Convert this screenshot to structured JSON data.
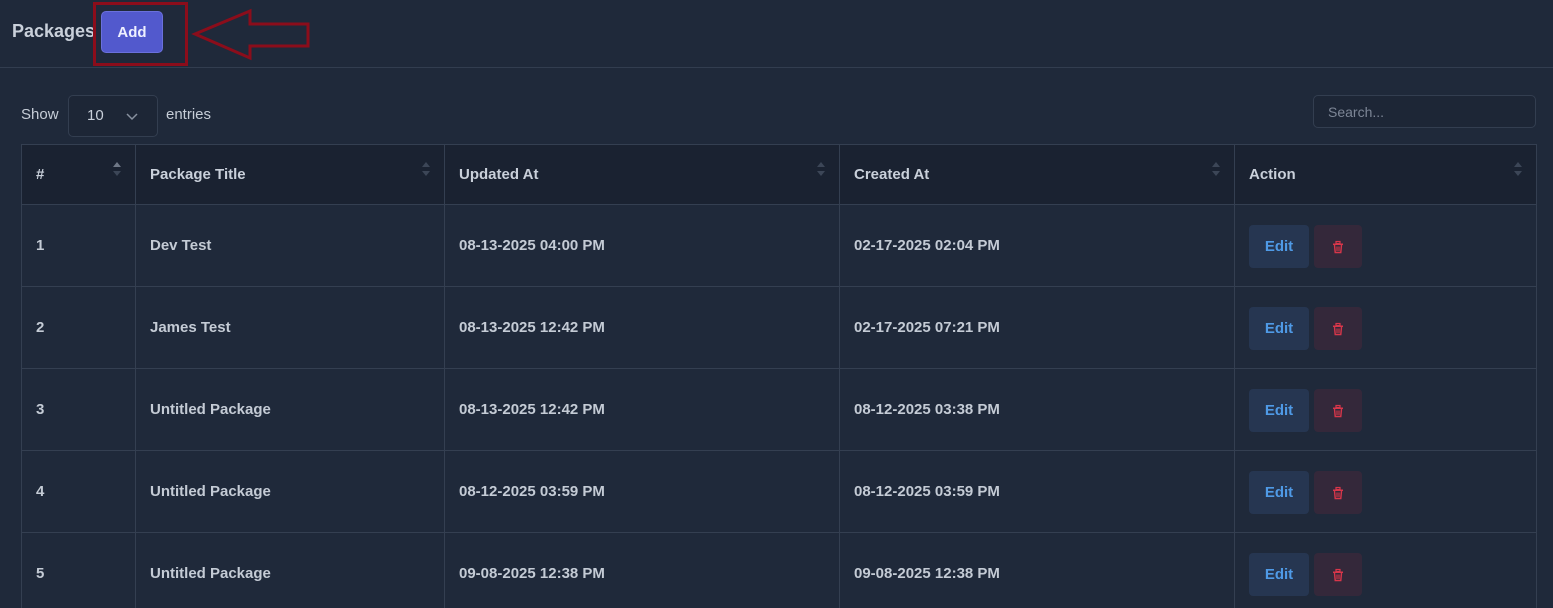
{
  "header": {
    "title": "Packages",
    "add_label": "Add"
  },
  "controls": {
    "show_label": "Show",
    "entries_value": "10",
    "entries_label": "entries",
    "search_placeholder": "Search..."
  },
  "table": {
    "columns": [
      "#",
      "Package Title",
      "Updated At",
      "Created At",
      "Action"
    ],
    "rows": [
      {
        "num": "1",
        "title": "Dev Test",
        "updated": "08-13-2025 04:00 PM",
        "created": "02-17-2025 02:04 PM",
        "edit": "Edit"
      },
      {
        "num": "2",
        "title": "James Test",
        "updated": "08-13-2025 12:42 PM",
        "created": "02-17-2025 07:21 PM",
        "edit": "Edit"
      },
      {
        "num": "3",
        "title": "Untitled Package",
        "updated": "08-13-2025 12:42 PM",
        "created": "08-12-2025 03:38 PM",
        "edit": "Edit"
      },
      {
        "num": "4",
        "title": "Untitled Package",
        "updated": "08-12-2025 03:59 PM",
        "created": "08-12-2025 03:59 PM",
        "edit": "Edit"
      },
      {
        "num": "5",
        "title": "Untitled Package",
        "updated": "09-08-2025 12:38 PM",
        "created": "09-08-2025 12:38 PM",
        "edit": "Edit"
      }
    ]
  },
  "colors": {
    "background": "#1f293a",
    "accent": "#5259cd",
    "edit_text": "#4f9ae6",
    "delete_icon": "#d8364a",
    "annotation": "#8b0d1b"
  },
  "icons": {
    "delete": "trash-icon",
    "select": "chevron-down-icon",
    "sort": "sort-icon",
    "annotation": "arrow-left-icon"
  }
}
